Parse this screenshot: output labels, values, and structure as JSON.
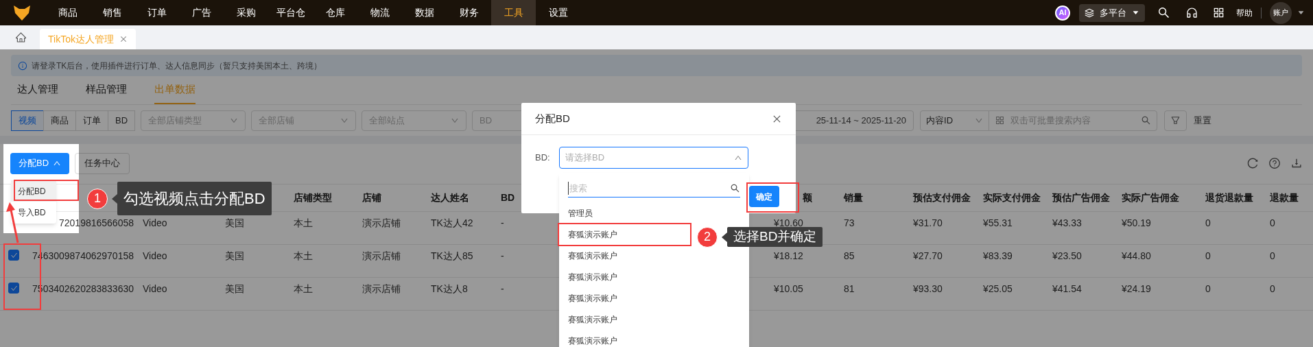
{
  "top_nav": {
    "items": [
      {
        "label": "商品",
        "selected": false
      },
      {
        "label": "销售",
        "selected": false
      },
      {
        "label": "订单",
        "selected": false
      },
      {
        "label": "广告",
        "selected": false
      },
      {
        "label": "采购",
        "selected": false
      },
      {
        "label": "平台仓",
        "selected": false
      },
      {
        "label": "仓库",
        "selected": false
      },
      {
        "label": "物流",
        "selected": false
      },
      {
        "label": "数据",
        "selected": false
      },
      {
        "label": "财务",
        "selected": false
      },
      {
        "label": "工具",
        "selected": true
      },
      {
        "label": "设置",
        "selected": false
      }
    ],
    "ai_badge": "AI",
    "platform": "多平台",
    "help": "帮助",
    "account": "账户"
  },
  "page_tabs": [
    {
      "label": "TikTok达人管理",
      "selected": true
    }
  ],
  "notice": "请登录TK后台，使用插件进行订单、达人信息同步（暂只支持美国本土、跨境）",
  "sub_tabs": [
    {
      "label": "达人管理",
      "selected": false
    },
    {
      "label": "样品管理",
      "selected": false
    },
    {
      "label": "出单数据",
      "selected": true
    }
  ],
  "filters": {
    "segments": [
      {
        "label": "视频",
        "selected": true
      },
      {
        "label": "商品",
        "selected": false
      },
      {
        "label": "订单",
        "selected": false
      },
      {
        "label": "BD",
        "selected": false
      }
    ],
    "selects": [
      "全部店铺类型",
      "全部店铺",
      "全部站点"
    ],
    "bd_placeholder": "BD",
    "date_range": "25-11-14 ~ 2025-11-20",
    "search_type": "内容ID",
    "search_placeholder": "双击可批量搜索内容",
    "reset": "重置"
  },
  "toolbar": {
    "assign_button": "分配BD",
    "assign_expanded": true,
    "menu": [
      {
        "label": "分配BD",
        "selected": true
      },
      {
        "label": "导入BD",
        "selected": false
      }
    ],
    "task_center": "任务中心"
  },
  "table": {
    "columns": [
      null,
      null,
      null,
      "店铺类型",
      "店铺",
      "达人姓名",
      "BD",
      "额",
      "销量",
      "预估支付佣金",
      "实际支付佣金",
      "预估广告佣金",
      "实际广告佣金",
      "退货退款量",
      "退款量"
    ],
    "rows": [
      {
        "cells": [
          "72019816566058",
          "Video",
          "美国",
          "本土",
          "演示店铺",
          "TK达人42",
          "-",
          "¥10.60",
          "73",
          "¥31.70",
          "¥55.31",
          "¥43.33",
          "¥50.19",
          "0",
          "0"
        ]
      },
      {
        "checked": true,
        "cells": [
          "7463009874062970158",
          "Video",
          "美国",
          "本土",
          "演示店铺",
          "TK达人85",
          "-",
          "¥18.12",
          "85",
          "¥27.70",
          "¥83.39",
          "¥23.50",
          "¥44.80",
          "0",
          "0"
        ]
      },
      {
        "checked": true,
        "cells": [
          "7503402620283833630",
          "Video",
          "美国",
          "本土",
          "演示店铺",
          "TK达人8",
          "-",
          "¥10.05",
          "81",
          "¥93.30",
          "¥25.05",
          "¥41.54",
          "¥24.19",
          "0",
          "0"
        ]
      }
    ]
  },
  "dialog": {
    "title": "分配BD",
    "field_label": "BD:",
    "placeholder": "请选择BD",
    "expanded": true,
    "ok_button": "确定",
    "dropdown": {
      "search_placeholder": "搜索",
      "options": [
        {
          "label": "管理员",
          "selected": false
        },
        {
          "label": "赛狐演示账户",
          "selected": false
        },
        {
          "label": "赛狐演示账户",
          "selected": false
        },
        {
          "label": "赛狐演示账户",
          "selected": false
        },
        {
          "label": "赛狐演示账户",
          "selected": false
        },
        {
          "label": "赛狐演示账户",
          "selected": false
        },
        {
          "label": "赛狐演示账户",
          "selected": false
        }
      ]
    }
  },
  "steps": [
    {
      "number": "1",
      "text": "勾选视频点击分配BD"
    },
    {
      "number": "2",
      "text": "选择BD并确定"
    }
  ]
}
